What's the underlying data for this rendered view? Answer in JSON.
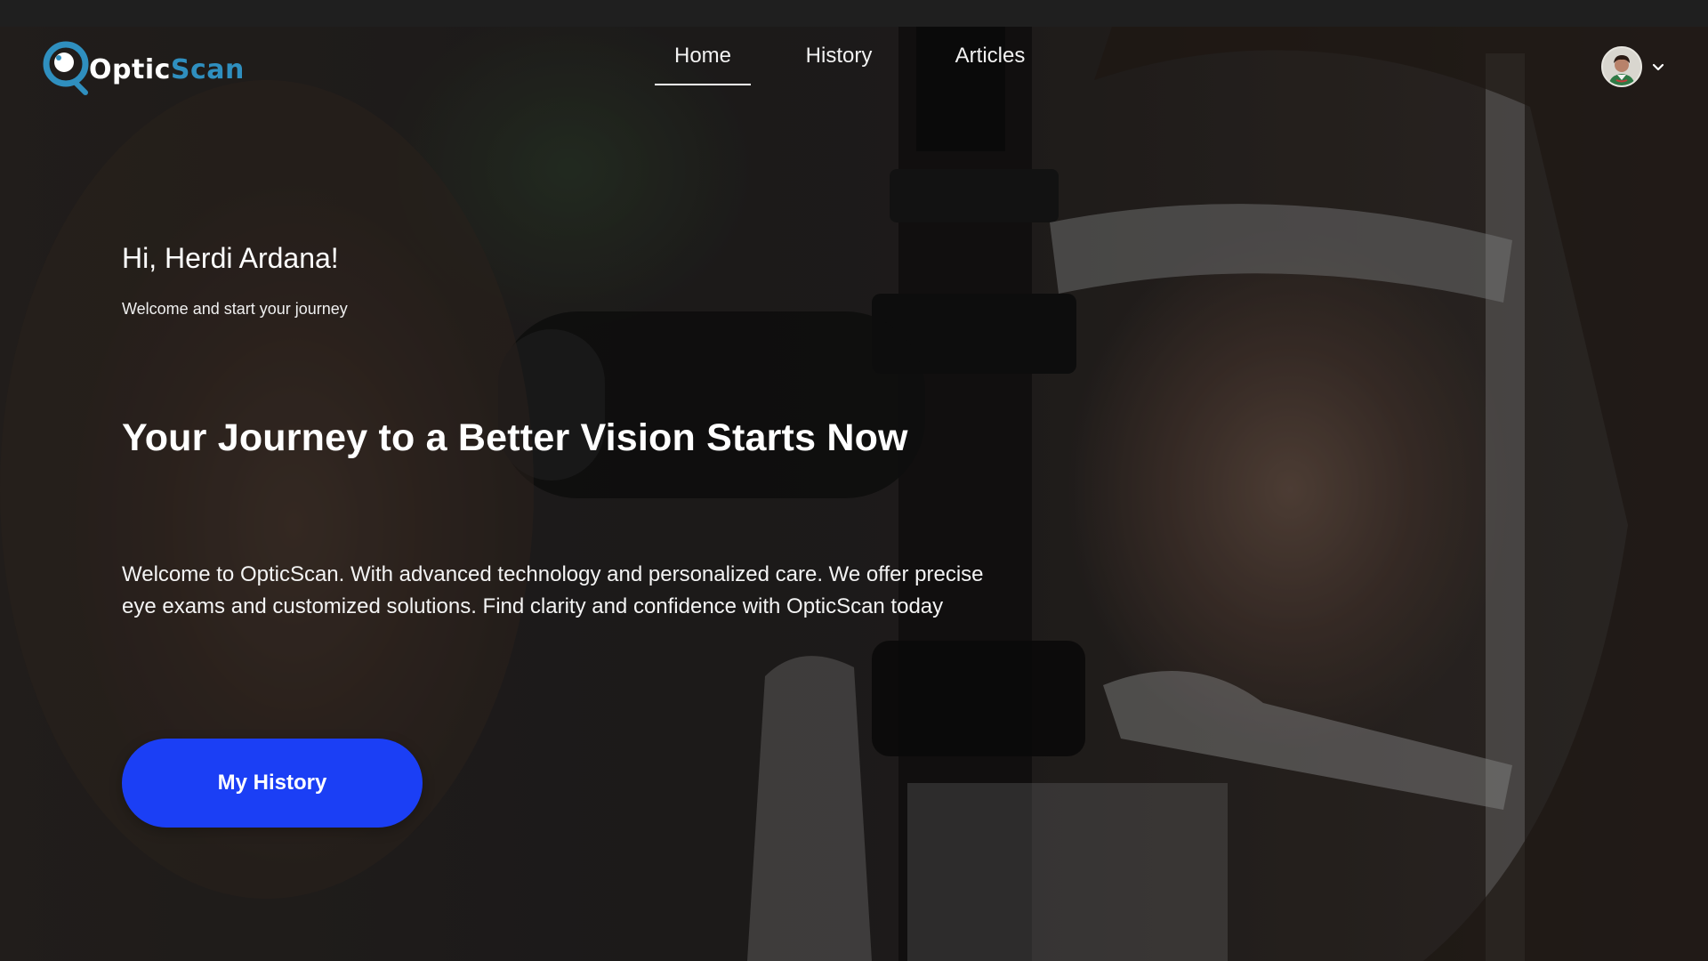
{
  "brand": {
    "name_prefix": "Optic",
    "name_suffix": "Scan"
  },
  "nav": {
    "items": [
      {
        "label": "Home",
        "active": true
      },
      {
        "label": "History",
        "active": false
      },
      {
        "label": "Articles",
        "active": false
      }
    ]
  },
  "profile": {
    "avatar_icon": "user-avatar",
    "menu_icon": "chevron-down-icon"
  },
  "hero": {
    "greeting": "Hi, Herdi Ardana!",
    "subtitle": "Welcome and start your journey",
    "headline": "Your Journey to a Better Vision Starts Now",
    "description": "Welcome to OpticScan. With advanced technology and personalized care. We offer precise eye exams and customized solutions. Find clarity and confidence with OpticScan today",
    "cta_label": "My History"
  },
  "colors": {
    "accent_blue": "#1b3ff5",
    "logo_accent": "#2f8fbf",
    "text_primary": "#ffffff"
  }
}
